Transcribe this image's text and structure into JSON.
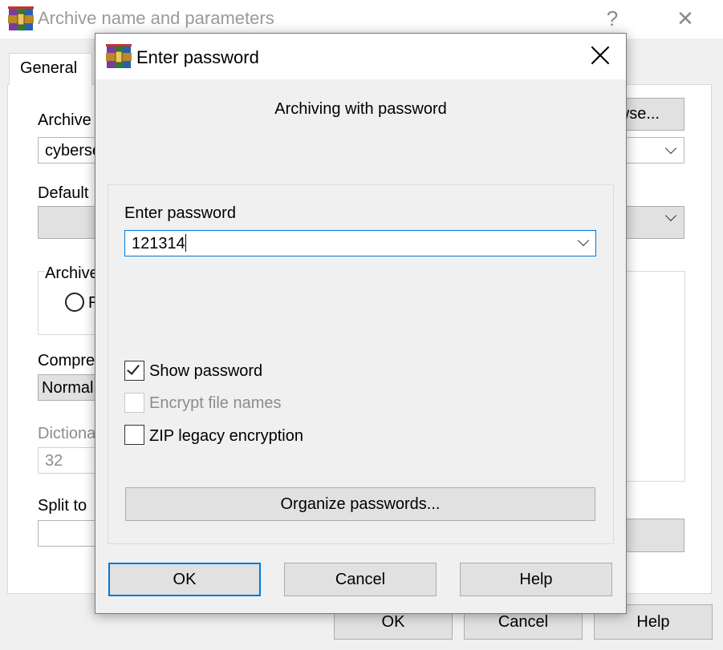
{
  "bg_window": {
    "title": "Archive name and parameters",
    "help_glyph": "?",
    "close_glyph": "✕",
    "tab_general": "General",
    "archive_label": "Archive",
    "archive_value": "cyberse",
    "browse_label": "wse...",
    "default_label": "Default",
    "archive_format_label": "Archive",
    "radio_letter": "R",
    "compression_label": "Compre",
    "compression_value": "Normal",
    "dictionary_label": "Dictiona",
    "dictionary_value": "32",
    "split_label": "Split to",
    "ok_label": "OK",
    "cancel_label": "Cancel",
    "help_label": "Help"
  },
  "dialog": {
    "title": "Enter password",
    "heading": "Archiving with password",
    "password_label": "Enter password",
    "password_value": "121314",
    "show_password": {
      "label": "Show password",
      "checked": true
    },
    "encrypt_file_names": {
      "label": "Encrypt file names",
      "checked": false,
      "enabled": false
    },
    "zip_legacy": {
      "label": "ZIP legacy encryption",
      "checked": false
    },
    "organize_label": "Organize passwords...",
    "ok_label": "OK",
    "cancel_label": "Cancel",
    "help_label": "Help"
  },
  "icons": {
    "app_icon": "winrar-books-icon",
    "close": "close-icon",
    "dropdown": "chevron-down-icon",
    "check": "checkmark-icon"
  },
  "colors": {
    "accent": "#0078d7",
    "button_face": "#e1e1e1",
    "window_bg": "#f0f0f0",
    "disabled_text": "#8c8c8c"
  }
}
